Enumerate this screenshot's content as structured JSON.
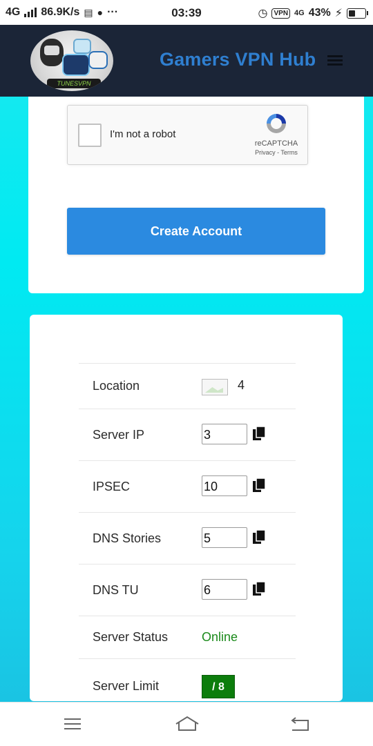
{
  "status_bar": {
    "network": "4G",
    "speed": "86.9K/s",
    "more": "···",
    "time": "03:39",
    "vpn": "VPN",
    "network2": "4G",
    "battery": "43%",
    "battery_level": 0.43
  },
  "header": {
    "logo_text": "TUNESVPN",
    "brand": "Gamers VPN Hub"
  },
  "recaptcha": {
    "label": "I'm not a robot",
    "brand": "reCAPTCHA",
    "terms": "Privacy - Terms"
  },
  "create_button": "Create Account",
  "server_info": {
    "location_label": "Location",
    "location_value": "4",
    "server_ip_label": "Server IP",
    "server_ip_value": "3",
    "ipsec_label": "IPSEC",
    "ipsec_value": "10",
    "dns_stories_label": "DNS Stories",
    "dns_stories_value": "5",
    "dns_tu_label": "DNS TU",
    "dns_tu_value": "6",
    "status_label": "Server Status",
    "status_value": "Online",
    "limit_label": "Server Limit",
    "limit_value": "/ 8"
  },
  "colors": {
    "accent": "#2b8ae0",
    "header_bg": "#1b2537",
    "brand": "#2f7fd0",
    "online": "#1a8a1a",
    "limit_badge": "#0c7d0c"
  }
}
